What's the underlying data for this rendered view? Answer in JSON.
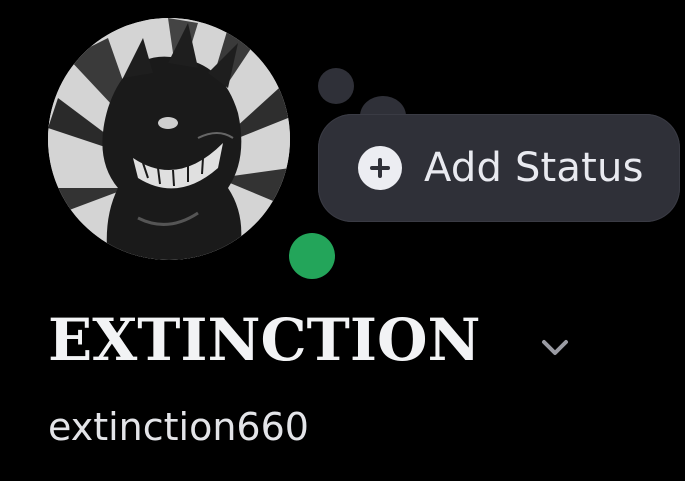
{
  "profile": {
    "display_name": "EXTINCTION",
    "username": "extinction660",
    "status": "online",
    "status_color": "#23a55a",
    "avatar_icon": "dragon-avatar"
  },
  "status_button": {
    "label": "Add Status",
    "icon": "plus-circle-icon"
  },
  "colors": {
    "background": "#000000",
    "bubble": "#2f3038",
    "text_primary": "#f2f3f5"
  }
}
